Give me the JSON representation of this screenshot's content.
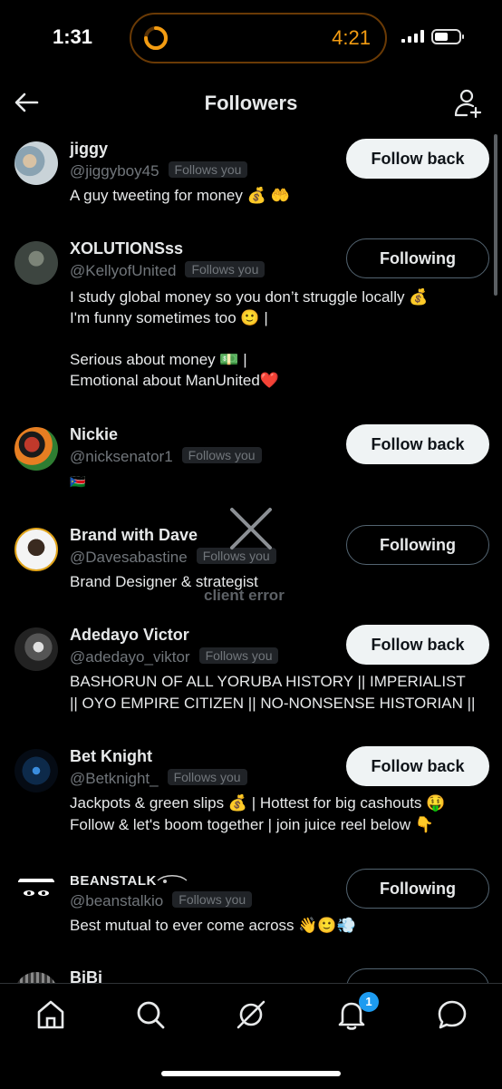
{
  "status_bar": {
    "time": "1:31",
    "timer": "4:21"
  },
  "header": {
    "title": "Followers"
  },
  "badge_label": "Follows you",
  "followers": [
    {
      "name": "jiggy",
      "handle": "@jiggyboy45",
      "bio": "A guy tweeting for money 💰 🤲",
      "button": "Follow back"
    },
    {
      "name": "XOLUTIONSss",
      "handle": "@KellyofUnited",
      "bio": "I study global money so you don’t struggle locally 💰\nI'm funny sometimes too 🙂 |\n\nSerious about money 💵 |\nEmotional about ManUnited❤️",
      "button": "Following"
    },
    {
      "name": "Nickie",
      "handle": "@nicksenator1",
      "bio": "🇸🇸",
      "button": "Follow back"
    },
    {
      "name": "Brand with Dave",
      "handle": "@Davesabastine",
      "bio": "Brand Designer & strategist",
      "button": "Following"
    },
    {
      "name": "Adedayo Victor",
      "handle": "@adedayo_viktor",
      "bio": "BASHORUN OF ALL YORUBA HISTORY || IMPERIALIST\n|| OYO EMPIRE CITIZEN || NO-NONSENSE HISTORIAN ||",
      "button": "Follow back"
    },
    {
      "name": "Bet Knight",
      "handle": "@Betknight_",
      "bio": "Jackpots & green slips 💰 | Hottest for big cashouts 🤑\nFollow & let's boom together | join juice reel below 👇",
      "button": "Follow back"
    },
    {
      "name": "BEANSTALK",
      "handle": "@beanstalkio",
      "bio": "Best mutual to ever come across 👋🙂💨",
      "button": "Following"
    },
    {
      "name": "BiBi"
    }
  ],
  "error": {
    "text": "client error"
  },
  "nav": {
    "notification_count": "1"
  },
  "icons": [
    "back-arrow-icon",
    "add-user-icon",
    "home-icon",
    "search-icon",
    "grok-icon",
    "bell-icon",
    "messages-icon",
    "close-icon"
  ],
  "colors": {
    "follow_back_bg": "#eff3f4",
    "following_border": "#536471",
    "accent": "#1d9bf0",
    "timer": "#f39c12"
  }
}
